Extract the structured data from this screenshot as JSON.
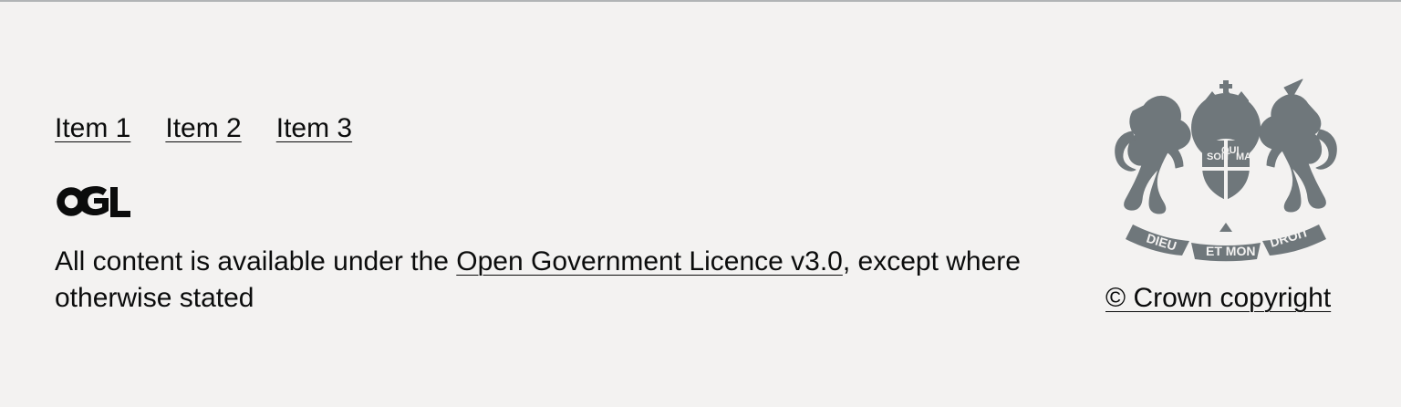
{
  "footer": {
    "links": [
      {
        "label": "Item 1"
      },
      {
        "label": "Item 2"
      },
      {
        "label": "Item 3"
      }
    ],
    "logo_icon": "ogl-logo-icon",
    "licence": {
      "prefix": "All content is available under the ",
      "link_text": "Open Government Licence v3.0",
      "suffix": ", except where otherwise stated"
    },
    "crest_icon": "royal-coat-of-arms-icon",
    "crest_text": {
      "left_ribbon": "DIEU",
      "center_ribbon": "ET MON",
      "right_ribbon": "DROIT",
      "garter": "HONI SOIT QUI MAL Y PENSE"
    },
    "copyright": "© Crown copyright"
  },
  "colors": {
    "background": "#f3f2f1",
    "text": "#0b0c0c",
    "border": "#b1b4b6",
    "crest": "#6f777b"
  }
}
